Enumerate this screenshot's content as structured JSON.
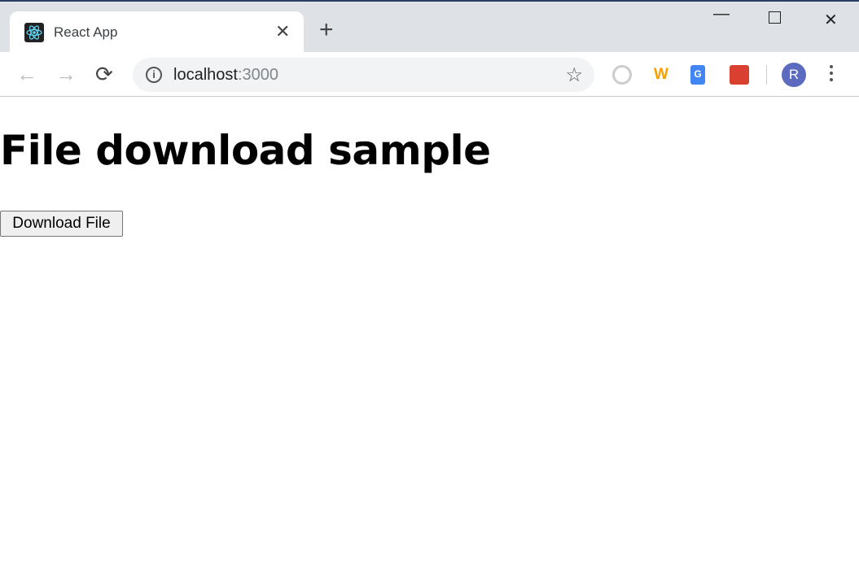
{
  "browser": {
    "tab": {
      "title": "React App",
      "favicon": "react-logo-icon"
    },
    "address": {
      "host": "localhost",
      "port": ":3000"
    },
    "profile_initial": "R",
    "extensions": [
      "circle-extension-icon",
      "w-extension-icon",
      "google-translate-icon",
      "react-debug-extension-icon"
    ],
    "accent": "#5c6bc0"
  },
  "page": {
    "heading": "File download sample",
    "button_label": "Download File"
  }
}
